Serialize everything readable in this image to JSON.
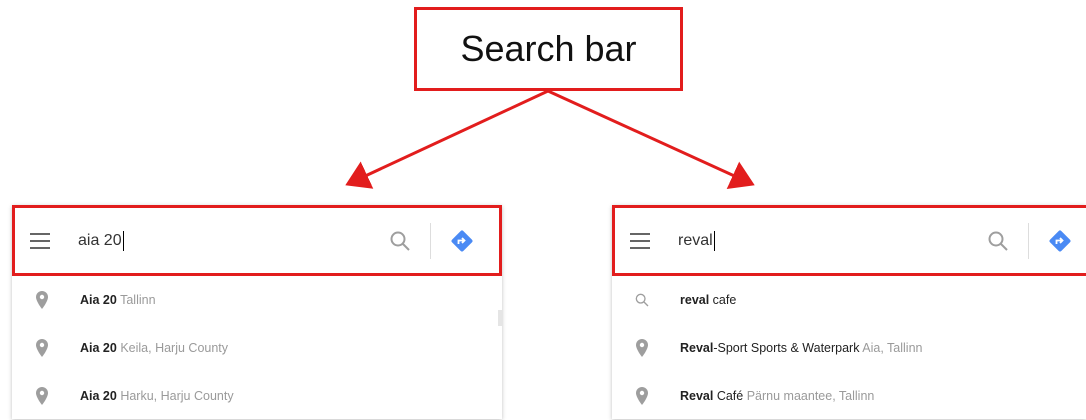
{
  "callout": {
    "label": "Search bar"
  },
  "left": {
    "query": "aia 20",
    "suggestions": [
      {
        "icon": "pin-icon",
        "main": "Aia 20",
        "secondary": "Tallinn"
      },
      {
        "icon": "pin-icon",
        "main": "Aia 20",
        "secondary": "Keila, Harju County"
      },
      {
        "icon": "pin-icon",
        "main": "Aia 20",
        "secondary": "Harku, Harju County"
      }
    ]
  },
  "right": {
    "query": "reval",
    "suggestions": [
      {
        "icon": "search-icon",
        "bold": "reval",
        "normal": " cafe",
        "secondary": ""
      },
      {
        "icon": "pin-icon",
        "bold": "Reval",
        "normal": "-Sport Sports & Waterpark",
        "secondary": " Aia, Tallinn"
      },
      {
        "icon": "pin-icon",
        "bold": "Reval",
        "normal": " Café",
        "secondary": " Pärnu maantee, Tallinn"
      }
    ]
  },
  "colors": {
    "highlight": "#e21d1d",
    "directions": "#4a8af4",
    "icon": "#9e9e9e"
  }
}
